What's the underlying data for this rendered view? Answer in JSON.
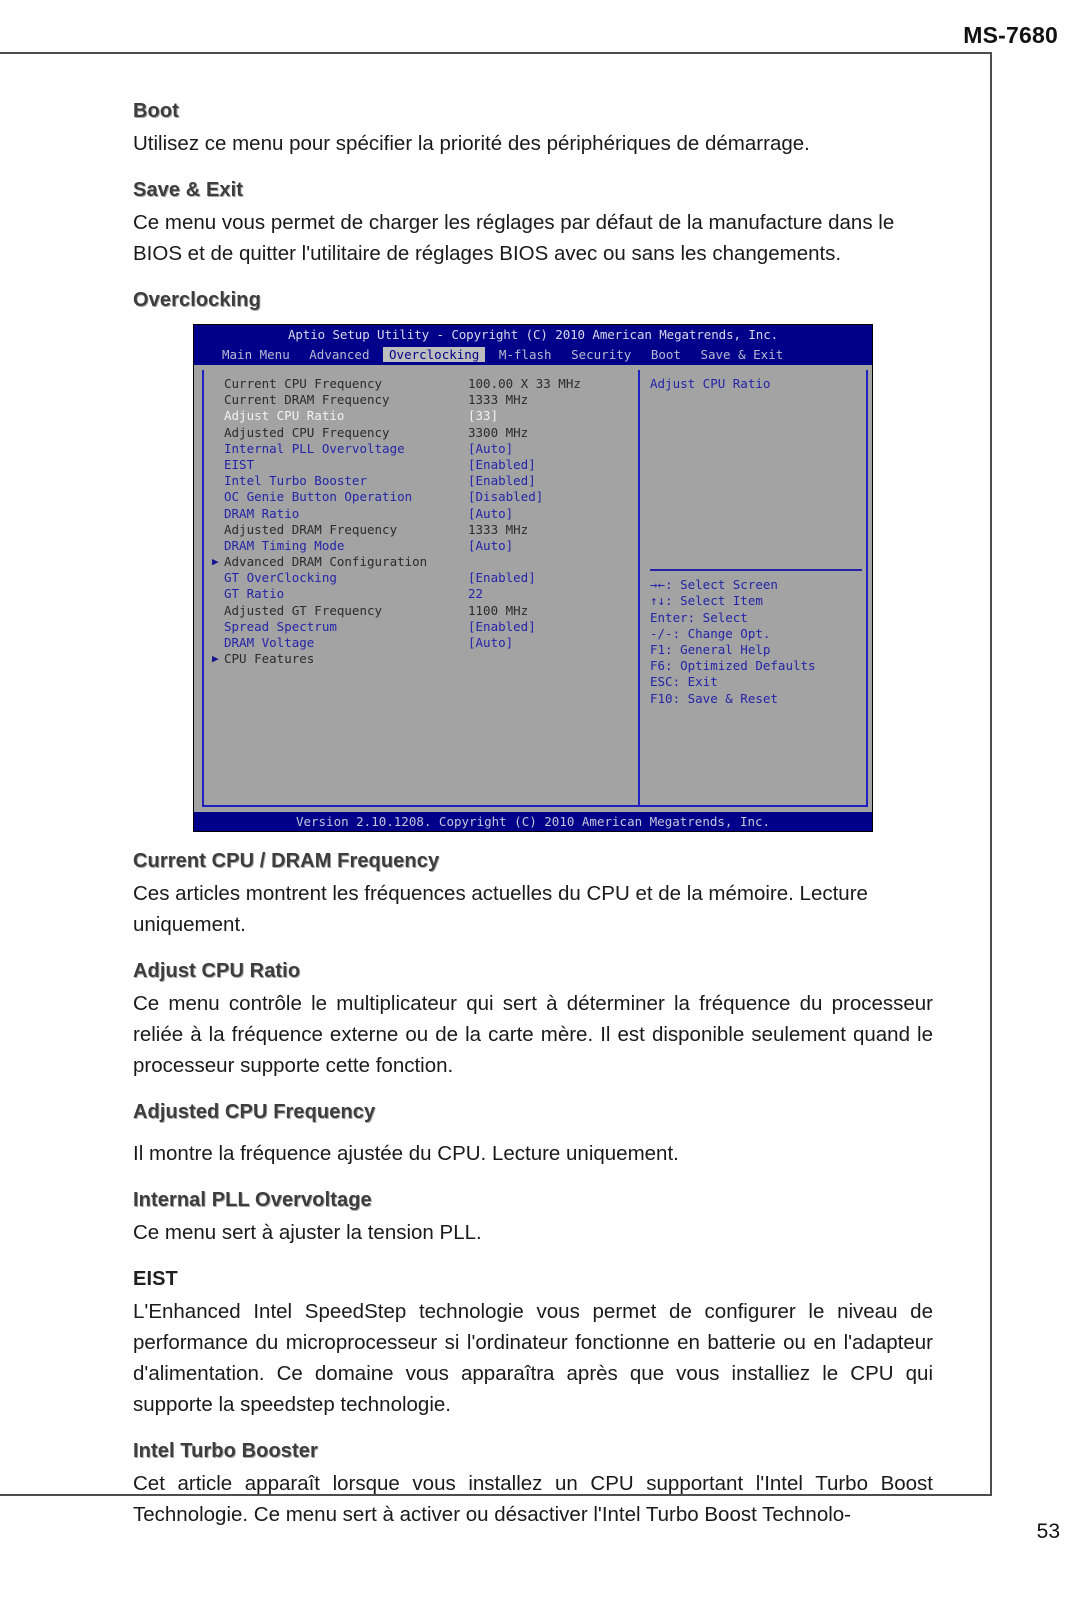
{
  "header": {
    "model": "MS-7680"
  },
  "page": {
    "number": "53"
  },
  "sections": [
    {
      "title": "Boot",
      "paragraphs": [
        "Utilisez ce menu pour spécifier la priorité des périphériques de démarrage."
      ]
    },
    {
      "title": "Save & Exit",
      "paragraphs": [
        "Ce menu vous permet de charger les réglages par défaut de la manufacture dans le BIOS et de quitter l'utilitaire de réglages BIOS avec ou sans les changements."
      ]
    },
    {
      "title": "Overclocking",
      "paragraphs": []
    },
    {
      "title": "Current CPU / DRAM Frequency",
      "paragraphs": [
        "Ces articles montrent les fréquences actuelles du CPU et de la mémoire. Lecture uniquement."
      ]
    },
    {
      "title": "Adjust CPU Ratio",
      "paragraphs": [
        "Ce menu contrôle le multiplicateur qui sert à déterminer la fréquence du processeur reliée à la fréquence externe ou de la carte mère. Il est disponible seulement quand le processeur supporte cette fonction."
      ]
    },
    {
      "title": "Adjusted CPU Frequency",
      "paragraphs": [
        "Il montre la fréquence ajustée du CPU. Lecture uniquement."
      ]
    },
    {
      "title": "Internal PLL Overvoltage",
      "paragraphs": [
        "Ce menu sert à ajuster la tension PLL."
      ]
    },
    {
      "title": "EIST",
      "paragraphs": [
        "L'Enhanced Intel SpeedStep technologie vous permet de configurer le niveau de performance du microprocesseur si l'ordinateur fonctionne en batterie ou en l'adapteur d'alimentation. Ce domaine vous apparaîtra après que vous installiez le CPU qui supporte la speedstep technologie."
      ]
    },
    {
      "title": "Intel Turbo Booster",
      "paragraphs": [
        "Cet article apparaît lorsque vous installez un CPU supportant l'Intel Turbo Boost Technologie. Ce menu sert à activer ou désactiver l'Intel Turbo Boost Technolo-"
      ]
    }
  ],
  "bios": {
    "title": "Aptio Setup Utility - Copyright (C) 2010 American Megatrends, Inc.",
    "menu": [
      {
        "label": "Main Menu",
        "active": false
      },
      {
        "label": "Advanced",
        "active": false
      },
      {
        "label": "Overclocking",
        "active": true
      },
      {
        "label": "M-flash",
        "active": false
      },
      {
        "label": "Security",
        "active": false
      },
      {
        "label": "Boot",
        "active": false
      },
      {
        "label": "Save & Exit",
        "active": false
      }
    ],
    "settings": [
      {
        "label": "Current CPU Frequency",
        "value": "100.00 X 33 MHz",
        "style": "dark",
        "arrow": false
      },
      {
        "label": "Current DRAM Frequency",
        "value": "1333 MHz",
        "style": "dark",
        "arrow": false
      },
      {
        "label": "Adjust CPU Ratio",
        "value": "[33]",
        "style": "white",
        "arrow": false
      },
      {
        "label": "Adjusted CPU Frequency",
        "value": "3300 MHz",
        "style": "dark",
        "arrow": false
      },
      {
        "label": "Internal PLL Overvoltage",
        "value": "[Auto]",
        "style": "blue",
        "arrow": false
      },
      {
        "label": "EIST",
        "value": "[Enabled]",
        "style": "blue",
        "arrow": false
      },
      {
        "label": "Intel Turbo Booster",
        "value": "[Enabled]",
        "style": "blue",
        "arrow": false
      },
      {
        "label": "OC Genie Button Operation",
        "value": "[Disabled]",
        "style": "blue",
        "arrow": false
      },
      {
        "label": "DRAM Ratio",
        "value": "[Auto]",
        "style": "blue",
        "arrow": false
      },
      {
        "label": "Adjusted DRAM Frequency",
        "value": "1333 MHz",
        "style": "dark",
        "arrow": false
      },
      {
        "label": "DRAM Timing Mode",
        "value": "[Auto]",
        "style": "blue",
        "arrow": false
      },
      {
        "label": "Advanced DRAM Configuration",
        "value": "",
        "style": "dark",
        "arrow": true
      },
      {
        "label": "GT OverClocking",
        "value": "[Enabled]",
        "style": "blue",
        "arrow": false
      },
      {
        "label": "GT Ratio",
        "value": "22",
        "style": "blue",
        "arrow": false
      },
      {
        "label": "Adjusted GT Frequency",
        "value": "1100 MHz",
        "style": "dark",
        "arrow": false
      },
      {
        "label": "Spread Spectrum",
        "value": "[Enabled]",
        "style": "blue",
        "arrow": false
      },
      {
        "label": "DRAM Voltage",
        "value": "[Auto]",
        "style": "blue",
        "arrow": false
      },
      {
        "label": "CPU Features",
        "value": "",
        "style": "dark",
        "arrow": true
      }
    ],
    "help_topic": "Adjust CPU Ratio",
    "help_keys": [
      "→←: Select Screen",
      "↑↓: Select Item",
      "Enter: Select",
      "-/-: Change Opt.",
      "F1: General Help",
      "F6: Optimized Defaults",
      "ESC: Exit",
      "F10: Save & Reset"
    ],
    "footer": "Version 2.10.1208. Copyright (C) 2010 American Megatrends, Inc."
  }
}
